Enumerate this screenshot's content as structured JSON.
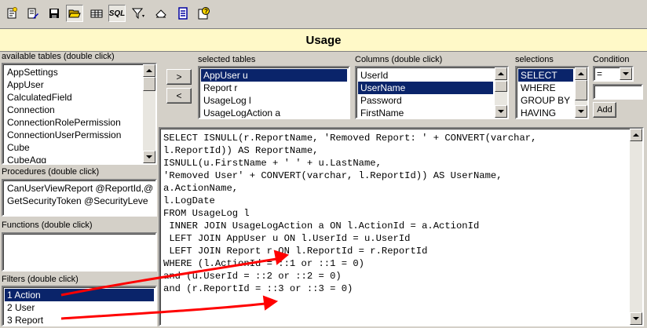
{
  "title": "Usage",
  "toolbar": {
    "sql_label": "SQL",
    "buttons": [
      "new-query-icon",
      "edit-icon",
      "save-icon",
      "open-folder-icon",
      "table-icon",
      "sql-icon",
      "filter-icon",
      "eraser-icon",
      "document-icon",
      "help-icon"
    ]
  },
  "available_tables": {
    "label": "available tables (double click)",
    "items": [
      "AppSettings",
      "AppUser",
      "CalculatedField",
      "Connection",
      "ConnectionRolePermission",
      "ConnectionUserPermission",
      "Cube",
      "CubeAgg"
    ]
  },
  "procedures": {
    "label": "Procedures (double click)",
    "items": [
      "CanUserViewReport @ReportId,@",
      "GetSecurityToken @SecurityLeve"
    ]
  },
  "functions": {
    "label": "Functions (double click)",
    "items": []
  },
  "filters": {
    "label": "Filters (double click)",
    "items": [
      "1 Action",
      "2 User",
      "3 Report"
    ],
    "selected_index": 0
  },
  "move_buttons": {
    "add": ">",
    "remove": "<"
  },
  "selected_tables": {
    "label": "selected tables",
    "items": [
      "AppUser u",
      "Report r",
      "UsageLog l",
      "UsageLogAction a"
    ],
    "selected_index": 0
  },
  "columns": {
    "label": "Columns (double click)",
    "items": [
      "UserId",
      "UserName",
      "Password",
      "FirstName"
    ],
    "selected_index": 1
  },
  "selections": {
    "label": "selections",
    "items": [
      "SELECT",
      "WHERE",
      "GROUP BY",
      "HAVING"
    ],
    "selected_index": 0
  },
  "condition": {
    "label": "Condition",
    "value": "=",
    "input_value": "",
    "add_label": "Add"
  },
  "sql_lines": [
    "SELECT ISNULL(r.ReportName, 'Removed Report: ' + CONVERT(varchar,",
    "l.ReportId)) AS ReportName,",
    "ISNULL(u.FirstName + ' ' + u.LastName,",
    "'Removed User' + CONVERT(varchar, l.ReportId)) AS UserName,",
    "a.ActionName,",
    "l.LogDate",
    "FROM UsageLog l",
    " INNER JOIN UsageLogAction a ON l.ActionId = a.ActionId",
    " LEFT JOIN AppUser u ON l.UserId = u.UserId",
    " LEFT JOIN Report r ON l.ReportId = r.ReportId",
    "WHERE (l.ActionId = ::1 or ::1 = 0)",
    "and (u.UserId = ::2 or ::2 = 0)",
    "and (r.ReportId = ::3 or ::3 = 0)"
  ],
  "colors": {
    "window": "#d4d0c8",
    "title_bg": "#fff9c8",
    "selection": "#0a246a",
    "annotation_arrow": "#ff0000"
  }
}
